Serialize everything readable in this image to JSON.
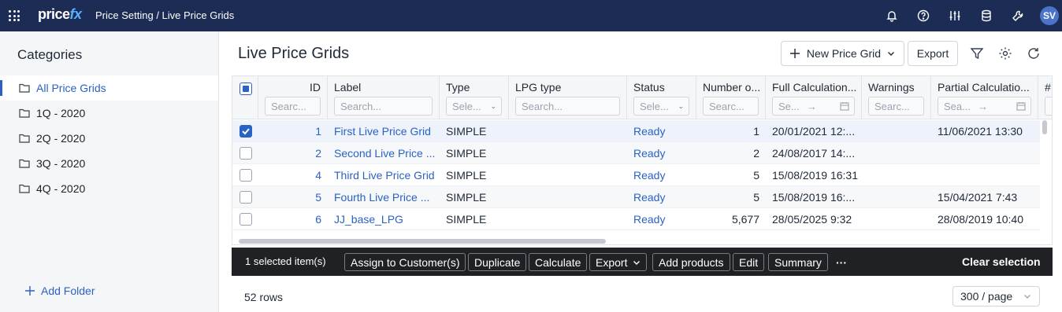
{
  "header": {
    "logo_text": "price",
    "logo_accent": "fx",
    "breadcrumb": "Price Setting / Live Price Grids",
    "avatar_initials": "SV",
    "icons": [
      "apps-grid-icon",
      "bell-icon",
      "help-icon",
      "sliders-icon",
      "database-icon",
      "tools-icon"
    ]
  },
  "sidebar": {
    "title": "Categories",
    "items": [
      {
        "label": "All Price Grids",
        "active": true
      },
      {
        "label": "1Q - 2020"
      },
      {
        "label": "2Q - 2020"
      },
      {
        "label": "3Q - 2020"
      },
      {
        "label": "4Q - 2020"
      }
    ],
    "add_folder": "Add Folder"
  },
  "main": {
    "title": "Live Price Grids",
    "new_button": "New Price Grid",
    "export_button": "Export"
  },
  "grid": {
    "columns": [
      {
        "label": "ID",
        "filter": "Searc..."
      },
      {
        "label": "Label",
        "filter": "Search..."
      },
      {
        "label": "Type",
        "filter": "Sele..."
      },
      {
        "label": "LPG type",
        "filter": "Search..."
      },
      {
        "label": "Status",
        "filter": "Sele..."
      },
      {
        "label": "Number o...",
        "filter": "Searc..."
      },
      {
        "label": "Full Calculation...",
        "filter": "Se..."
      },
      {
        "label": "Warnings",
        "filter": "Searc..."
      },
      {
        "label": "Partial Calculatio...",
        "filter": "Sea..."
      },
      {
        "label": "#",
        "filter": ""
      }
    ],
    "rows": [
      {
        "id": "1",
        "label": "First Live Price Grid",
        "type": "SIMPLE",
        "lpg_type": "",
        "status": "Ready",
        "number": "1",
        "full_calc": "20/01/2021 12:...",
        "warnings": "",
        "partial_calc": "11/06/2021 13:30",
        "selected": true
      },
      {
        "id": "2",
        "label": "Second Live Price ...",
        "type": "SIMPLE",
        "lpg_type": "",
        "status": "Ready",
        "number": "2",
        "full_calc": "24/08/2017 14:...",
        "warnings": "",
        "partial_calc": "",
        "selected": false
      },
      {
        "id": "4",
        "label": "Third Live Price Grid",
        "type": "SIMPLE",
        "lpg_type": "",
        "status": "Ready",
        "number": "5",
        "full_calc": "15/08/2019 16:31",
        "warnings": "",
        "partial_calc": "",
        "selected": false
      },
      {
        "id": "5",
        "label": "Fourth Live Price ...",
        "type": "SIMPLE",
        "lpg_type": "",
        "status": "Ready",
        "number": "5",
        "full_calc": "15/08/2019 16:...",
        "warnings": "",
        "partial_calc": "15/04/2021 7:43",
        "selected": false
      },
      {
        "id": "6",
        "label": "JJ_base_LPG",
        "type": "SIMPLE",
        "lpg_type": "",
        "status": "Ready",
        "number": "5,677",
        "full_calc": "28/05/2025 9:32",
        "warnings": "",
        "partial_calc": "28/08/2019 10:40",
        "selected": false
      }
    ]
  },
  "selection_bar": {
    "count": "1 selected item(s)",
    "actions": [
      "Assign to Customer(s)",
      "Duplicate",
      "Calculate",
      "Export",
      "Add products",
      "Edit",
      "Summary"
    ],
    "more": "···",
    "clear": "Clear selection"
  },
  "footer": {
    "rows": "52 rows",
    "page_size": "300 / page"
  },
  "colors": {
    "topbar": "#1d2c54",
    "accent": "#2a62c4",
    "selection_bar": "#1f2124"
  }
}
